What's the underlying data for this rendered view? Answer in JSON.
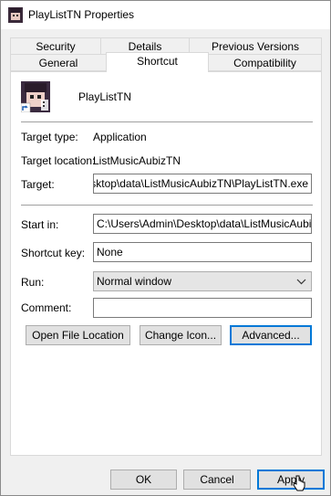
{
  "window": {
    "title": "PlayListTN Properties"
  },
  "tabs": {
    "row1": [
      "Security",
      "Details",
      "Previous Versions"
    ],
    "row2": [
      "General",
      "Shortcut",
      "Compatibility"
    ]
  },
  "shortcut": {
    "name": "PlayListTN",
    "target_type_label": "Target type:",
    "target_type_value": "Application",
    "target_location_label": "Target location:",
    "target_location_value": "ListMusicAubizTN",
    "target_label": "Target:",
    "target_value": "\\Desktop\\data\\ListMusicAubizTN\\PlayListTN.exe",
    "start_in_label": "Start in:",
    "start_in_value": "C:\\Users\\Admin\\Desktop\\data\\ListMusicAubizTN",
    "shortcut_key_label": "Shortcut key:",
    "shortcut_key_value": "None",
    "run_label": "Run:",
    "run_value": "Normal window",
    "comment_label": "Comment:",
    "comment_value": ""
  },
  "actions": {
    "open_file_location": "Open File Location",
    "change_icon": "Change Icon...",
    "advanced": "Advanced..."
  },
  "dialog": {
    "ok": "OK",
    "cancel": "Cancel",
    "apply": "Apply"
  },
  "colors": {
    "focus": "#0078d7",
    "button": "#e1e1e1",
    "panel": "#ffffff",
    "dialog_bg": "#f0f0f0"
  }
}
